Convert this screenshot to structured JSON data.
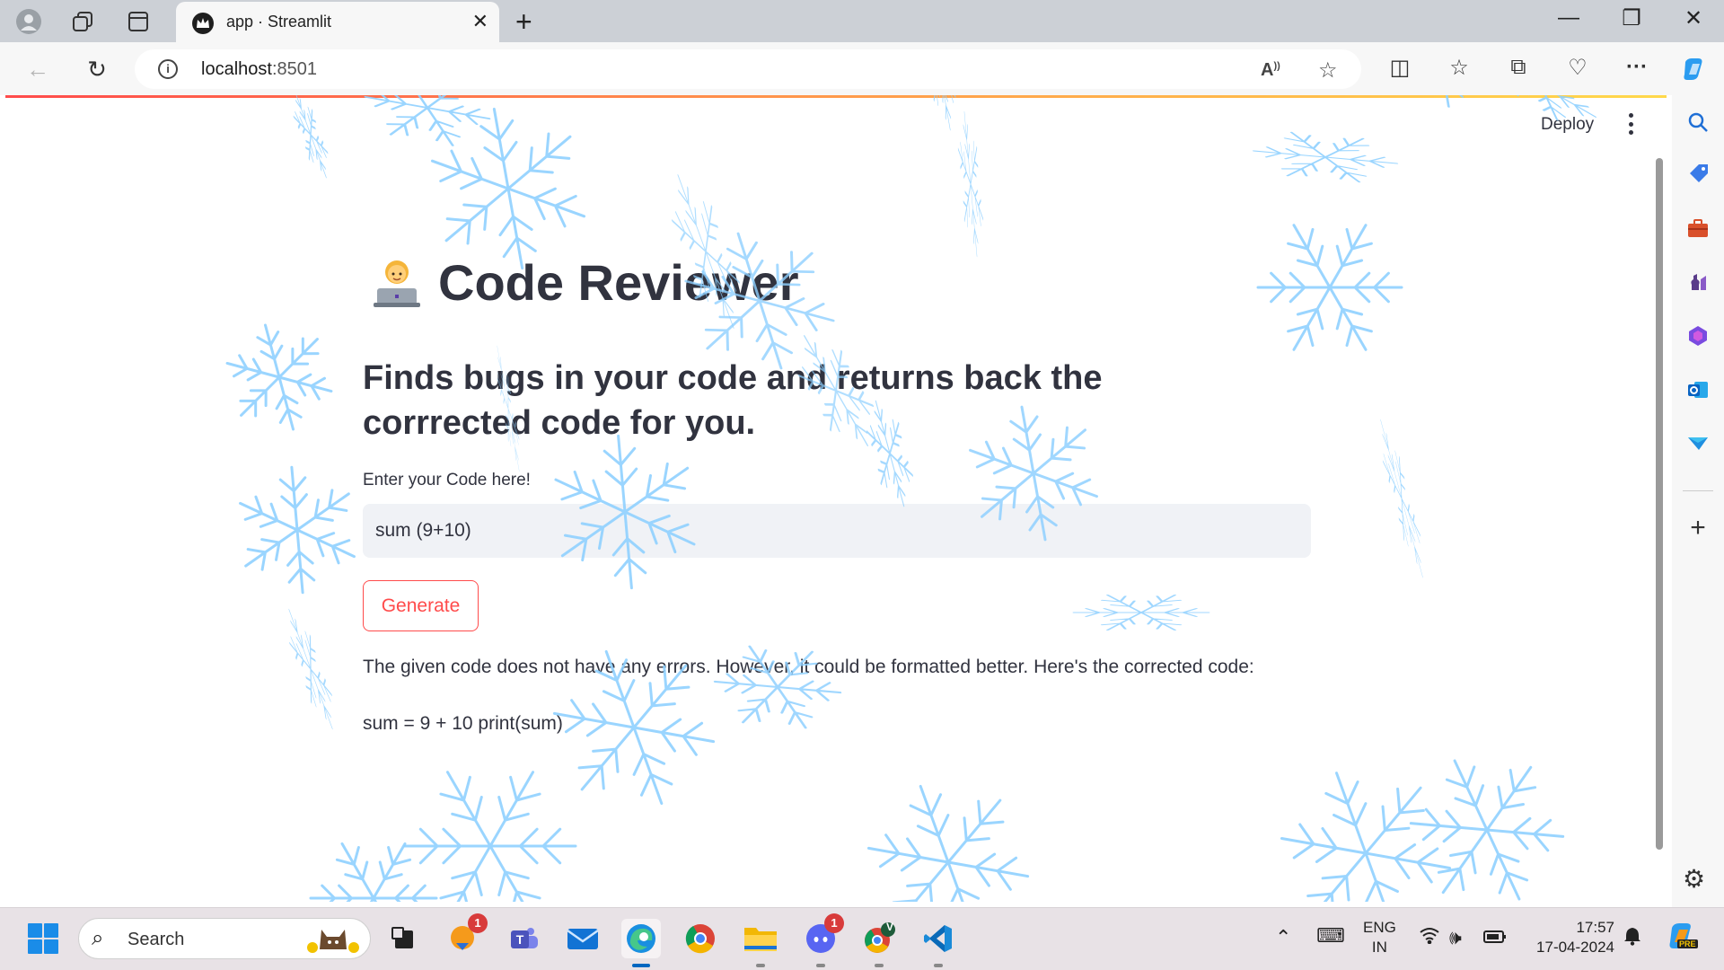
{
  "browser": {
    "tab_title": "app · Streamlit",
    "url_host": "localhost",
    "url_port": ":8501"
  },
  "app": {
    "deploy_label": "Deploy",
    "title_emoji": "technologist",
    "title": "Code Reviewer",
    "subheader": "Finds bugs in your code and returns back the corrrected code for you.",
    "input_label": "Enter your Code here!",
    "input_value": "sum (9+10)",
    "generate_label": "Generate",
    "response_text": "The given code does not have any errors. However, it could be formatted better. Here's the corrected code:",
    "corrected_code": "sum = 9 + 10 print(sum)",
    "effect": "snow"
  },
  "taskbar": {
    "search_placeholder": "Search",
    "notification_badge_1": "1",
    "notification_badge_2": "1",
    "profile_initial": "V",
    "lang_line1": "ENG",
    "lang_line2": "IN",
    "time": "17:57",
    "date": "17-04-2024",
    "copilot_badge": "PRE"
  },
  "colors": {
    "accent": "#ff4b4b",
    "text": "#31333f",
    "input_bg": "#f0f2f6",
    "snowflake": "#8fd0ff"
  }
}
